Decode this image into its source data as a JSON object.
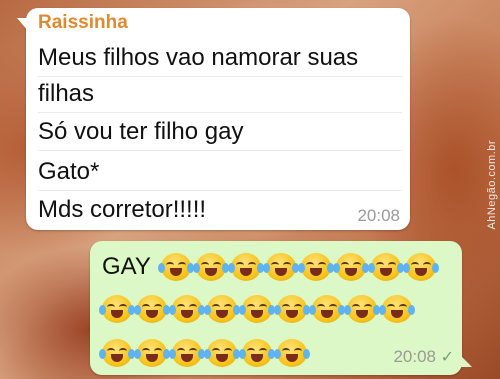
{
  "incoming": {
    "sender": "Raissinha",
    "lines": [
      "Meus filhos vao namorar suas",
      "filhas",
      "Só vou ter filho gay",
      "Gato*",
      "Mds corretor!!!!!"
    ],
    "time": "20:08"
  },
  "outgoing": {
    "text": "GAY",
    "emoji_name": "face-with-tears-of-joy",
    "emoji_rows": [
      8,
      9,
      6
    ],
    "time": "20:08",
    "status_icon": "check-icon"
  },
  "watermark": "AhNegão.com.br"
}
